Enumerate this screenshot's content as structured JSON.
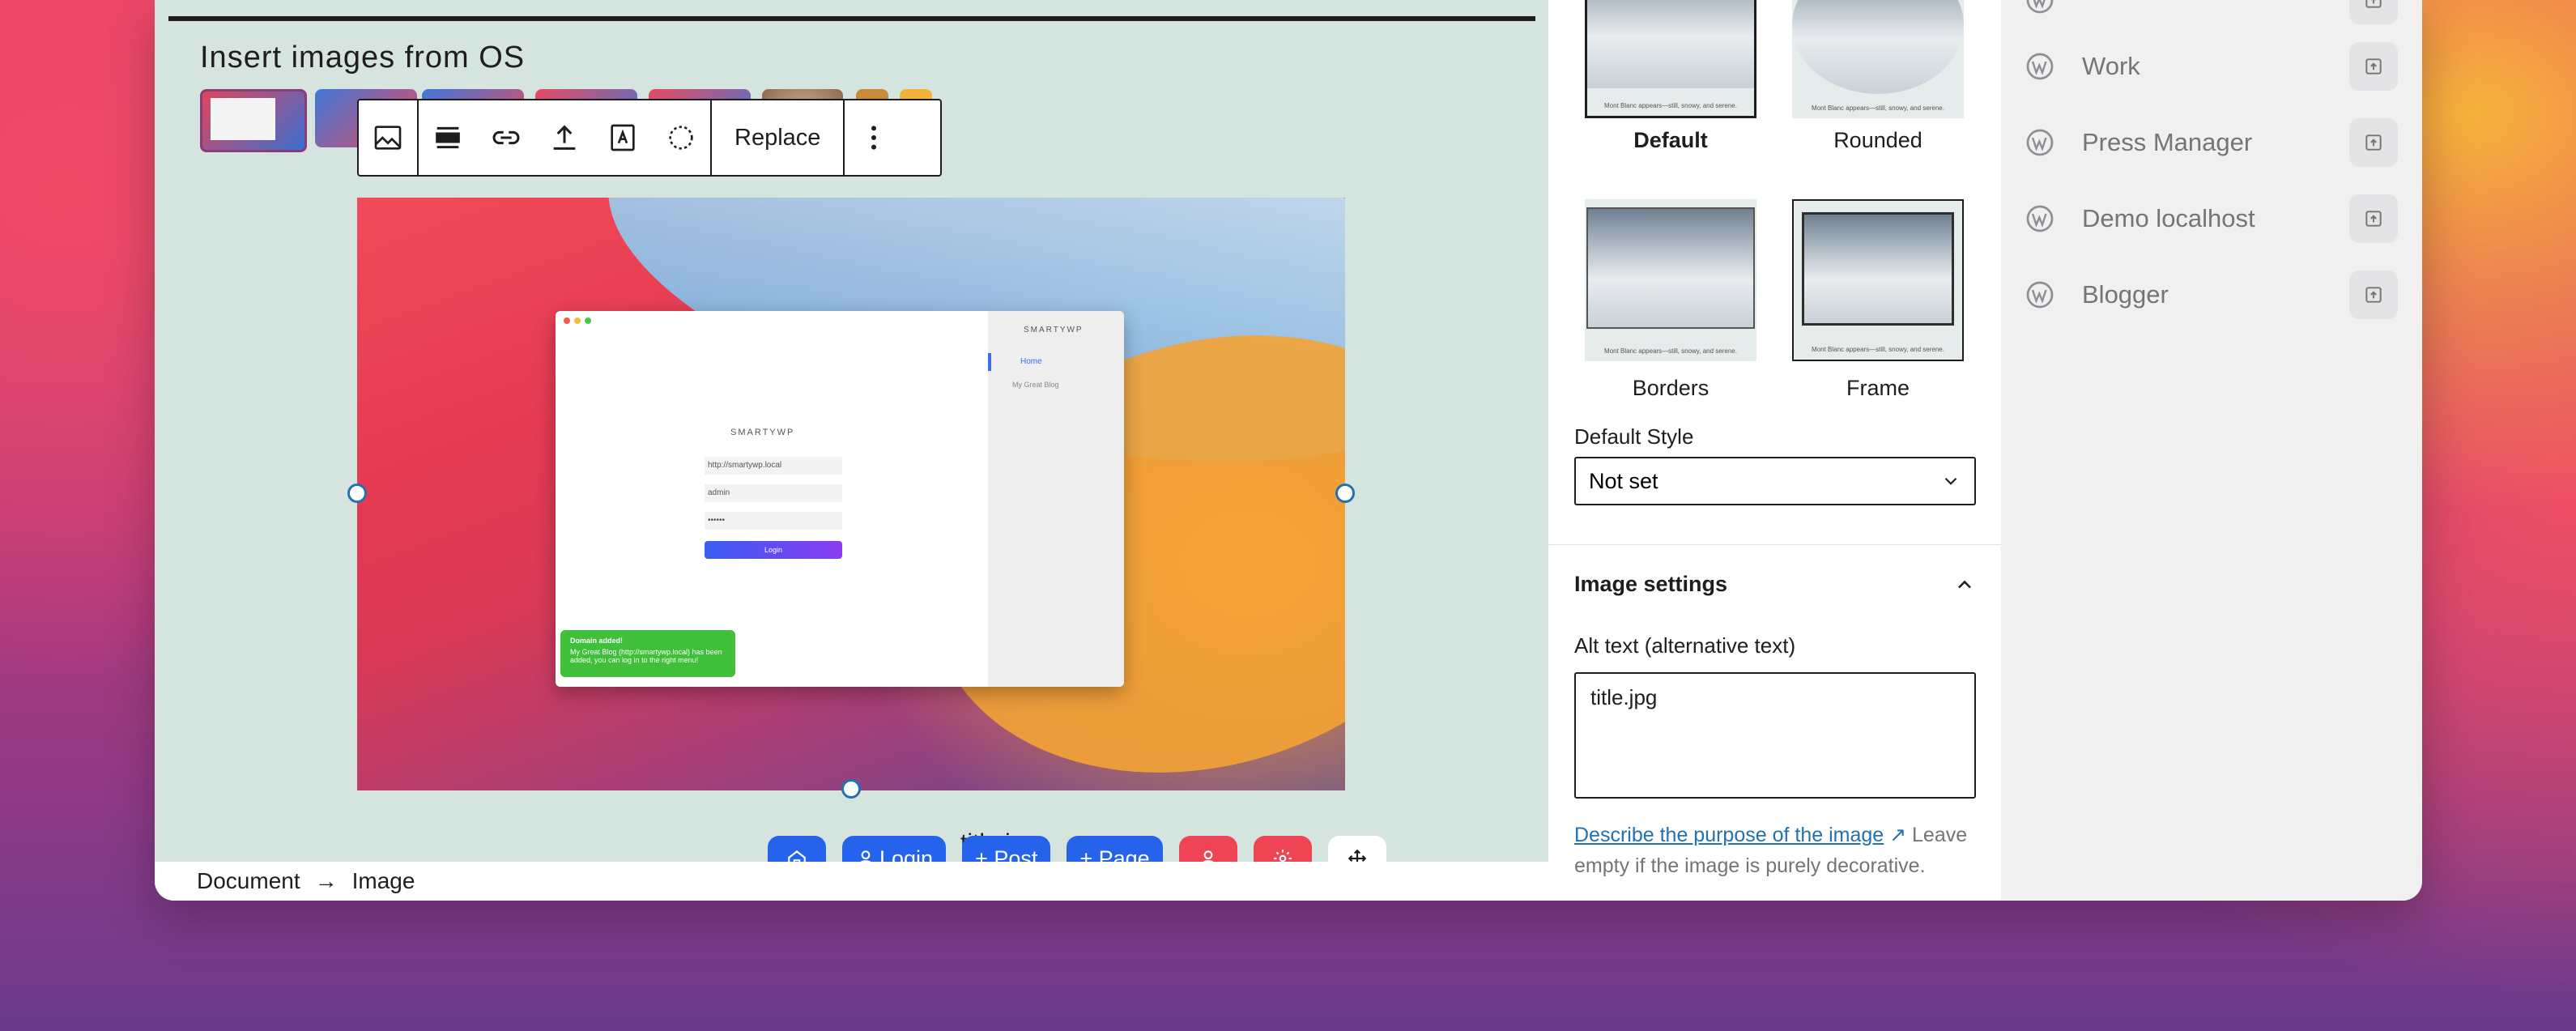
{
  "editor": {
    "heading": "Insert images from OS",
    "toolbar": {
      "replace_label": "Replace"
    },
    "image": {
      "mock_logo": "SMARTYWP",
      "mock_url": "http://smartywp.local",
      "mock_user": "admin",
      "mock_password": "••••••",
      "mock_login": "Login",
      "mock_home": "Home",
      "mock_blog": "My Great Blog",
      "mock_toast_title": "Domain added!",
      "mock_toast_body": "My Great Blog (http://smartywp.local) has been added, you can log in to the right menu!"
    },
    "caption": "title.j"
  },
  "floating_toolbar": {
    "login": "Login",
    "post": "+ Post",
    "page": "+ Page"
  },
  "breadcrumb": {
    "items": [
      "Document",
      "Image"
    ]
  },
  "settings": {
    "styles": [
      {
        "label": "Default",
        "selected": true
      },
      {
        "label": "Rounded"
      },
      {
        "label": "Borders"
      },
      {
        "label": "Frame"
      }
    ],
    "style_caption": "Mont Blanc appears—still, snowy, and serene.",
    "default_style_label": "Default Style",
    "default_style_value": "Not set",
    "image_settings_title": "Image settings",
    "alt_label": "Alt text (alternative text)",
    "alt_value": "title.jpg",
    "help_link": "Describe the purpose of the image",
    "help_text": "Leave empty if the image is purely decorative."
  },
  "sites": {
    "items": [
      {
        "name": "Work"
      },
      {
        "name": "Press Manager"
      },
      {
        "name": "Demo localhost"
      },
      {
        "name": "Blogger"
      }
    ]
  }
}
